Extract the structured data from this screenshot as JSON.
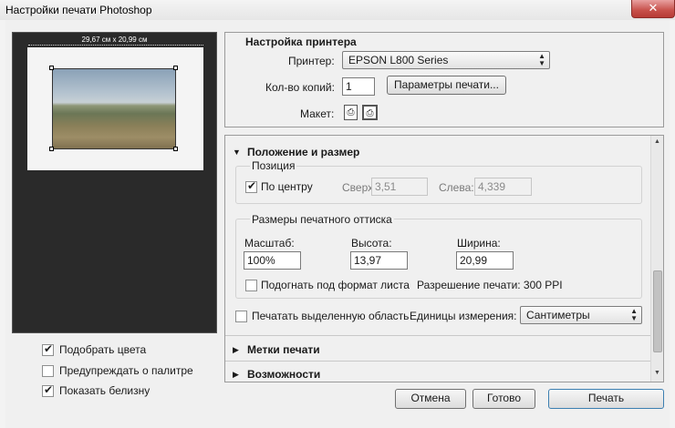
{
  "window": {
    "title": "Настройки печати Photoshop",
    "close_glyph": "✕"
  },
  "preview": {
    "dimensions": "29,67 см x 20,99 см"
  },
  "left_options": [
    {
      "label": "Подобрать цвета",
      "checked": true
    },
    {
      "label": "Предупреждать о палитре",
      "checked": false
    },
    {
      "label": "Показать белизну",
      "checked": true
    }
  ],
  "printer_setup": {
    "heading": "Настройка принтера",
    "printer_label": "Принтер:",
    "printer_value": "EPSON L800 Series",
    "copies_label": "Кол-во копий:",
    "copies_value": "1",
    "print_settings_button": "Параметры печати...",
    "layout_label": "Макет:"
  },
  "position_size": {
    "heading": "Положение и размер",
    "position_group": "Позиция",
    "center_label": "По центру",
    "center_checked": true,
    "top_label": "Сверху:",
    "top_value": "3,51",
    "left_label": "Слева:",
    "left_value": "4,339",
    "scaled_group": "Размеры печатного оттиска",
    "scale_label": "Масштаб:",
    "scale_value": "100%",
    "height_label": "Высота:",
    "height_value": "13,97",
    "width_label": "Ширина:",
    "width_value": "20,99",
    "fit_label": "Подогнать под формат листа",
    "fit_checked": false,
    "resolution_text": "Разрешение печати: 300 PPI",
    "print_selected_label": "Печатать выделенную область",
    "print_selected_checked": false,
    "units_label": "Единицы измерения:",
    "units_value": "Сантиметры"
  },
  "sections": {
    "print_marks": "Метки печати",
    "functions": "Возможности"
  },
  "buttons": {
    "cancel": "Отмена",
    "done": "Готово",
    "print": "Печать"
  }
}
